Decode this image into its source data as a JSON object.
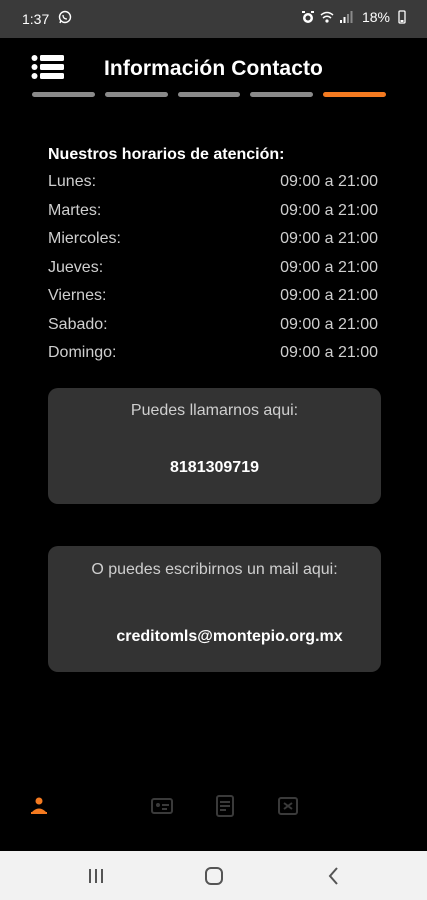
{
  "status_bar": {
    "time": "1:37",
    "battery_percent": "18%",
    "icons": [
      "whatsapp-icon",
      "alarm-icon",
      "wifi-icon",
      "signal-icon",
      "battery-icon"
    ]
  },
  "header": {
    "title": "Información Contacto",
    "progress_segments": 5,
    "active_segment": 5
  },
  "schedule": {
    "heading": "Nuestros horarios de atención:",
    "rows": [
      {
        "day": "Lunes:",
        "hours": "09:00 a 21:00"
      },
      {
        "day": "Martes:",
        "hours": "09:00 a 21:00"
      },
      {
        "day": "Miercoles:",
        "hours": "09:00 a 21:00"
      },
      {
        "day": "Jueves:",
        "hours": "09:00 a 21:00"
      },
      {
        "day": "Viernes:",
        "hours": "09:00 a 21:00"
      },
      {
        "day": "Sabado:",
        "hours": "09:00 a 21:00"
      },
      {
        "day": "Domingo:",
        "hours": "09:00 a 21:00"
      }
    ]
  },
  "phone_card": {
    "label": "Puedes llamarnos aqui:",
    "phone": "8181309719"
  },
  "mail_card": {
    "label": "O puedes escribirnos un mail aqui:",
    "email": "creditomls@montepio.org.mx"
  },
  "bottom_tabs": [
    {
      "icon": "person-icon",
      "active": true
    },
    {
      "icon": "id-card-icon",
      "active": false
    },
    {
      "icon": "document-icon",
      "active": false
    },
    {
      "icon": "checklist-icon",
      "active": false
    }
  ],
  "colors": {
    "accent": "#f47a20",
    "background": "#000000",
    "card": "#333333",
    "inactive": "#8a8a8a"
  }
}
